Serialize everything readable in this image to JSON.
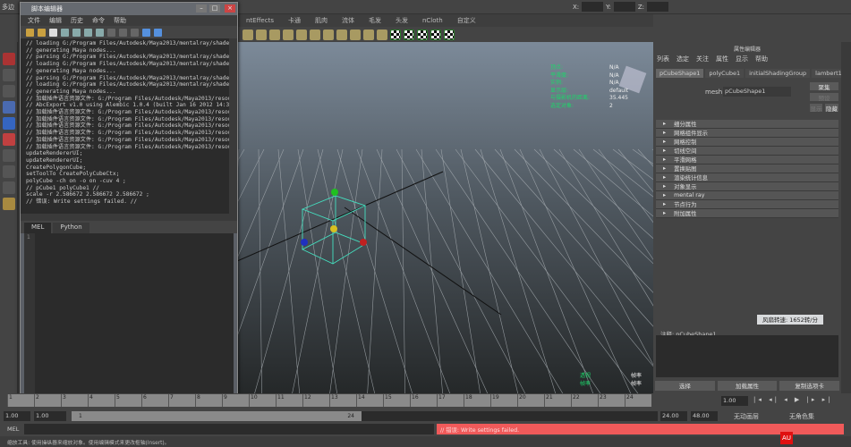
{
  "main_menu_label": "多边",
  "coord_labels": {
    "x": "X:",
    "y": "Y:",
    "z": "Z:"
  },
  "shelf_tabs": [
    "ntEffects",
    "卡通",
    "肌肉",
    "流体",
    "毛发",
    "头发",
    "nCloth",
    "自定义"
  ],
  "script_editor": {
    "title": "脚本编辑器",
    "menu": [
      "文件",
      "编辑",
      "历史",
      "命令",
      "帮助"
    ],
    "history": [
      "// loading G:/Program Files/Autodesk/Maya2013/mentalray/shaders/",
      "// generating Maya nodes...",
      "// parsing G:/Program Files/Autodesk/Maya2013/mentalray/shaders/",
      "// loading G:/Program Files/Autodesk/Maya2013/mentalray/shaders/",
      "// generating Maya nodes...",
      "// parsing G:/Program Files/Autodesk/Maya2013/mentalray/shaders/",
      "// loading G:/Program Files/Autodesk/Maya2013/mentalray/shaders/",
      "// generating Maya nodes...",
      "// 加载插件语言资源文件: G:/Program Files/Autodesk/Maya2013/resourc",
      "// AbcExport v1.0 using Alembic 1.0.4 (built Jan 16 2012 14:33:1",
      "// 加载插件语言资源文件: G:/Program Files/Autodesk/Maya2013/resourc",
      "// 加载插件语言资源文件: G:/Program Files/Autodesk/Maya2013/resourc",
      "// 加载插件语言资源文件: G:/Program Files/Autodesk/Maya2013/resourc",
      "// 加载插件语言资源文件: G:/Program Files/Autodesk/Maya2013/resourc",
      "// 加载插件语言资源文件: G:/Program Files/Autodesk/Maya2013/resourc",
      "// 加载插件语言资源文件: G:/Program Files/Autodesk/Maya2013/resourc",
      "updateRendererUI;",
      "updateRendererUI;",
      "CreatePolygonCube;",
      "setToolTo CreatePolyCubeCtx;",
      "polyCube -ch on -o on -cuv 4 ;",
      "// pCube1 polyCube1 //",
      "scale -r 2.586672 2.586672 2.586672 ;",
      "// 错误: Write settings failed. //"
    ],
    "tabs": [
      "MEL",
      "Python"
    ],
    "line_number": "1"
  },
  "hud": {
    "labels": [
      "顶点:",
      "平滑度:",
      "实例:",
      "显示层:",
      "与摄影机的距离:",
      "选定对象:"
    ],
    "values": [
      "N/A",
      "N/A",
      "N/A",
      "default",
      "35.445",
      "2"
    ],
    "bottom_labels": [
      "透视",
      "帧率"
    ],
    "bottom_values": [
      "帧率",
      "帧率"
    ]
  },
  "attribute_editor": {
    "title": "属性编辑器",
    "menu": [
      "列表",
      "选定",
      "关注",
      "属性",
      "显示",
      "帮助"
    ],
    "tabs": [
      "pCubeShape1",
      "polyCube1",
      "initialShadingGroup",
      "lambert1"
    ],
    "mesh_label": "mesh:",
    "mesh_value": "pCubeShape1",
    "focus_label": "聚集",
    "preset_label": "预设",
    "show_label": "显示",
    "hide_label": "隐藏",
    "sections": [
      "细分属性",
      "网格组件显示",
      "网格控制",
      "切线空间",
      "平滑网格",
      "置换贴图",
      "渲染统计信息",
      "对象显示",
      "mental ray",
      "节点行为",
      "附加属性"
    ],
    "speed_button": "风扇转速: 1652转/分",
    "notes_label": "注释: pCubeShape1",
    "buttons": [
      "选择",
      "加载属性",
      "复制选项卡"
    ]
  },
  "timeline": {
    "ticks": [
      "1",
      "2",
      "3",
      "4",
      "5",
      "6",
      "7",
      "8",
      "9",
      "10",
      "11",
      "12",
      "13",
      "14",
      "15",
      "16",
      "17",
      "18",
      "19",
      "20",
      "21",
      "22",
      "23",
      "24"
    ],
    "current": "1.00"
  },
  "range": {
    "start": "1.00",
    "playback_start": "1.00",
    "slider_start": "1",
    "slider_end": "24",
    "playback_end": "24.00",
    "end": "48.00",
    "anim_layer": "无动画层",
    "char_set": "无角色集"
  },
  "command": {
    "label": "MEL",
    "result": "// 错误: Write settings failed."
  },
  "help_line": "缩放工具: 使用操纵器来缩放对象。使用编辑模式来更改枢轴(Insert)。",
  "watermark": "AU",
  "colors": {
    "error": "#f05a5a",
    "hud": "#1bd86a",
    "cube": "#44e0c0"
  }
}
